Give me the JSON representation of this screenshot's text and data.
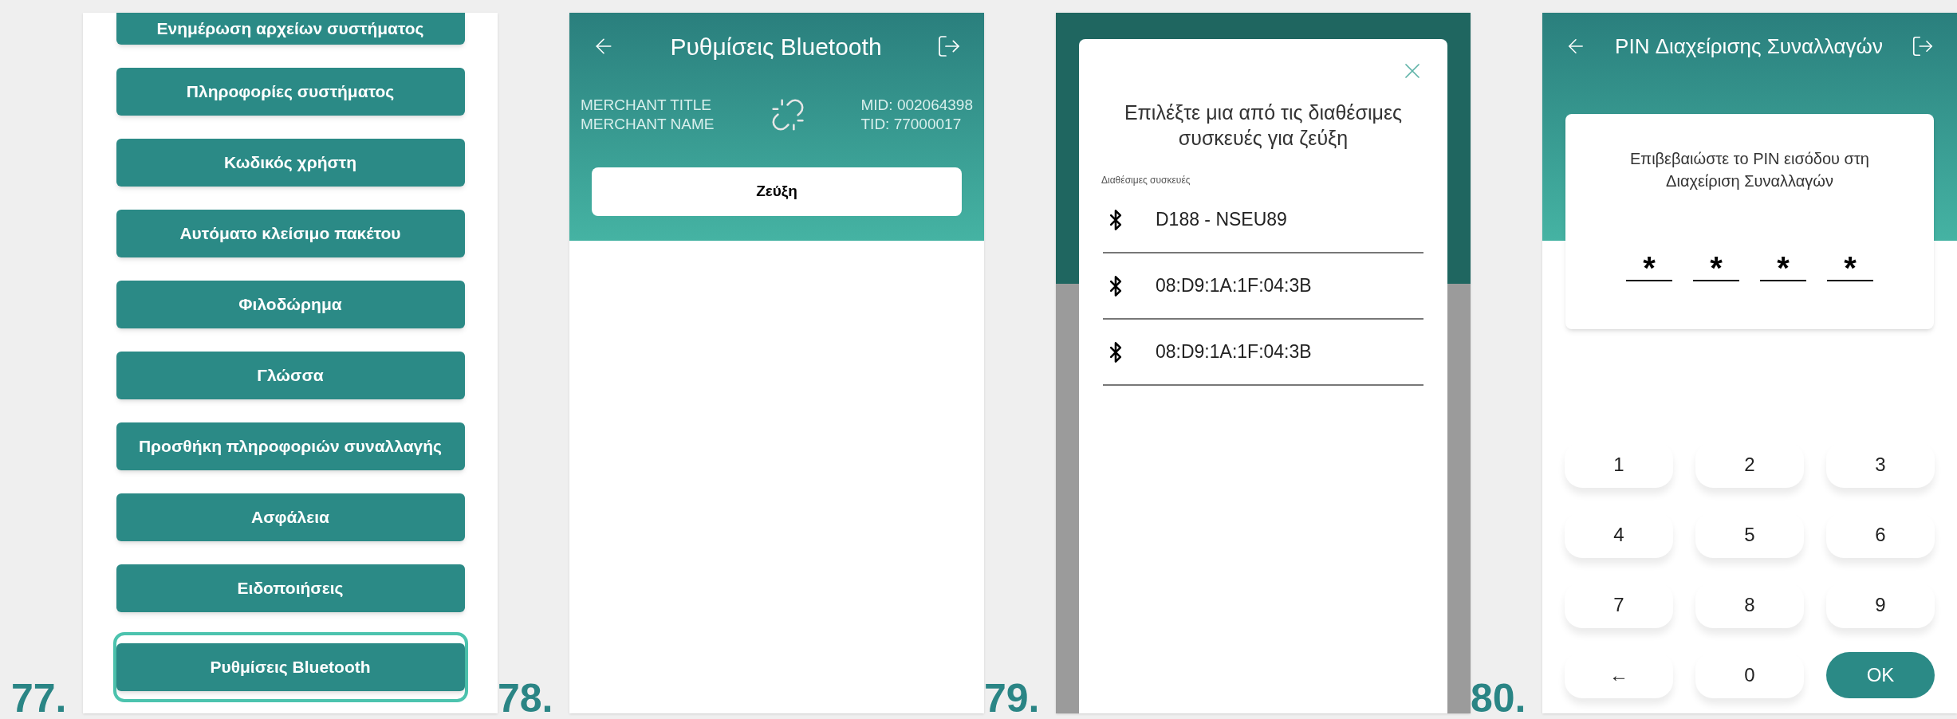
{
  "screens": [
    {
      "step": "77.",
      "kind": "menu",
      "menu_items": [
        {
          "label": "Ενημέρωση αρχείων συστήματος",
          "selected": false
        },
        {
          "label": "Πληροφορίες συστήματος",
          "selected": false
        },
        {
          "label": "Κωδικός χρήστη",
          "selected": false
        },
        {
          "label": "Αυτόματο κλείσιμο πακέτου",
          "selected": false
        },
        {
          "label": "Φιλοδώρημα",
          "selected": false
        },
        {
          "label": "Γλώσσα",
          "selected": false
        },
        {
          "label": "Προσθήκη πληροφοριών συναλλαγής",
          "selected": false
        },
        {
          "label": "Ασφάλεια",
          "selected": false
        },
        {
          "label": "Ειδοποιήσεις",
          "selected": false
        },
        {
          "label": "Ρυθμίσεις Bluetooth",
          "selected": true
        }
      ]
    },
    {
      "step": "78.",
      "kind": "bluetooth_settings",
      "title": "Ρυθμίσεις Bluetooth",
      "merchant_title": "MERCHANT TITLE",
      "merchant_name": "MERCHANT NAME",
      "mid": "MID: 002064398",
      "tid": "TID: 77000017",
      "pair_button": "Ζεύξη"
    },
    {
      "step": "79.",
      "kind": "device_dialog",
      "title": "Επιλέξτε μια από τις διαθέσιμες συσκευές για ζεύξη",
      "section_label": "Διαθέσιμες συσκευές",
      "devices": [
        "D188 - NSEU89",
        "08:D9:1A:1F:04:3B",
        "08:D9:1A:1F:04:3B"
      ]
    },
    {
      "step": "80.",
      "kind": "pin_entry",
      "title": "PIN Διαχείρισης Συναλλαγών",
      "prompt": "Επιβεβαιώστε το PIN εισόδου στη Διαχείριση Συναλλαγών",
      "pin_digits": [
        "*",
        "*",
        "*",
        "*"
      ],
      "keypad": [
        {
          "label": "1",
          "kind": "key"
        },
        {
          "label": "2",
          "kind": "key"
        },
        {
          "label": "3",
          "kind": "key"
        },
        {
          "label": "4",
          "kind": "key"
        },
        {
          "label": "5",
          "kind": "key"
        },
        {
          "label": "6",
          "kind": "key"
        },
        {
          "label": "7",
          "kind": "key"
        },
        {
          "label": "8",
          "kind": "key"
        },
        {
          "label": "9",
          "kind": "key"
        },
        {
          "label": "←",
          "kind": "key"
        },
        {
          "label": "0",
          "kind": "key"
        },
        {
          "label": "OK",
          "kind": "confirm"
        }
      ]
    }
  ]
}
